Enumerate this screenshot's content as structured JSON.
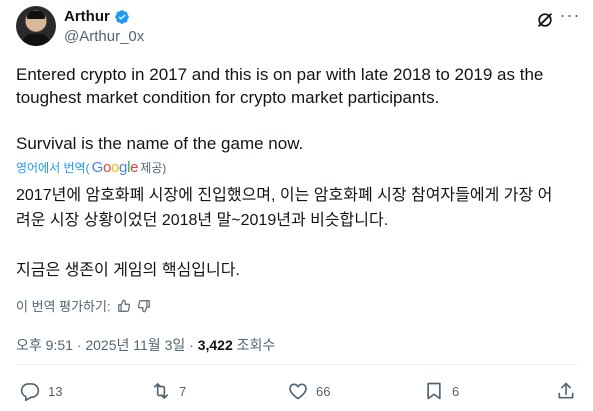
{
  "author": {
    "name": "Arthur",
    "handle": "@Arthur_0x"
  },
  "tweet": {
    "text": "Entered crypto in 2017 and this is on par with late 2018 to 2019 as the\ntoughest market condition for crypto market participants.\n\nSurvival is the name of the game now.",
    "translated_label_prefix": "영어에서 번역(",
    "translated_label_brand": "Google",
    "translated_label_suffix": " 제공)",
    "translated_text": "2017년에 암호화폐 시장에 진입했으며, 이는 암호화폐 시장 참여자들에게 가장 어\n려운 시장 상황이었던 2018년 말~2019년과 비슷합니다.\n\n지금은 생존이 게임의 핵심입니다.",
    "rate_translation": "이 번역 평가하기:"
  },
  "meta": {
    "time": "오후 9:51",
    "date": "2025년 11월 3일",
    "views_count": "3,422",
    "views_label": "조회수",
    "separator": "·"
  },
  "actions": {
    "replies": "13",
    "reposts": "7",
    "likes": "66",
    "bookmarks": "6"
  },
  "icons": {
    "verified": "verified-badge-icon",
    "grok": "grok-icon",
    "more": "more-icon",
    "reply": "reply-icon",
    "repost": "repost-icon",
    "like": "like-icon",
    "bookmark": "bookmark-icon",
    "share": "share-icon",
    "thumbs_up": "thumbs-up-icon",
    "thumbs_down": "thumbs-down-icon"
  },
  "colors": {
    "accent": "#1d9bf0",
    "muted": "#536471",
    "text": "#0f1419"
  }
}
